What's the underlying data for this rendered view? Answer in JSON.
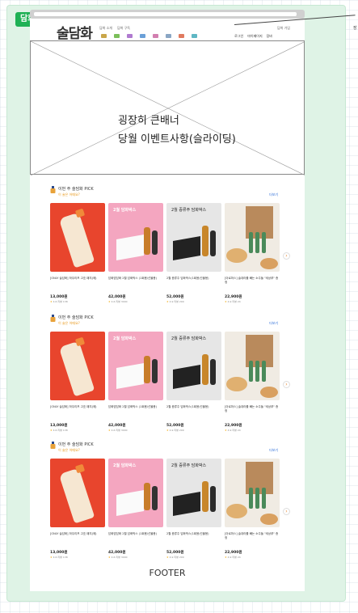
{
  "board": {
    "label": "담화마켓"
  },
  "header": {
    "logo": "술담화",
    "topnav": [
      "담화 소개",
      "담화 구독"
    ],
    "signup": "담화 가입",
    "usernav": [
      "로그인",
      "마이페이지",
      "장바"
    ],
    "annotation": "장"
  },
  "banner": {
    "line1": "굉장히 큰배너",
    "line2": "당월 이벤트사항(슬라이딩)"
  },
  "sections": [
    {
      "title": "이번 주 술담화 PICK",
      "subtitle": "이 술은 어때요?",
      "more": "더보기"
    },
    {
      "title": "이번 주 술담화 PICK",
      "subtitle": "이 술은 어때요?",
      "more": "더보기"
    },
    {
      "title": "이번 주 술담화 PICK",
      "subtitle": "이 술은 어때요?",
      "more": "더보기"
    }
  ],
  "products": [
    {
      "name": "[ONLY 술담화] 하우리프 고흐 패치(에)",
      "price": "13,000원",
      "rating": "4.6",
      "reviews": "리뷰 138",
      "img_text": ""
    },
    {
      "name": "담화밤담화 2월 담화박스 (1회용/선물용)",
      "price": "42,000원",
      "rating": "4.6",
      "reviews": "리뷰 3000",
      "img_text": "2월\n담화박스"
    },
    {
      "name": "2월 증류주 담화박스(1회용/선물용)",
      "price": "52,000원",
      "rating": "4.9",
      "reviews": "리뷰 299",
      "img_text": "2월\n증류주 담화박스"
    },
    {
      "name": "[아로마스] 술대라를 빼는 소주들 \"세상쭈\" 증정",
      "price": "22,900원",
      "rating": "4.9",
      "reviews": "리뷰 24",
      "img_text": ""
    }
  ],
  "footer": "FOOTER",
  "colors": {
    "board_bg": "#dff3e6",
    "badge": "#1fb155",
    "accent_orange": "#e89a1e",
    "link_blue": "#2a6bd6"
  }
}
